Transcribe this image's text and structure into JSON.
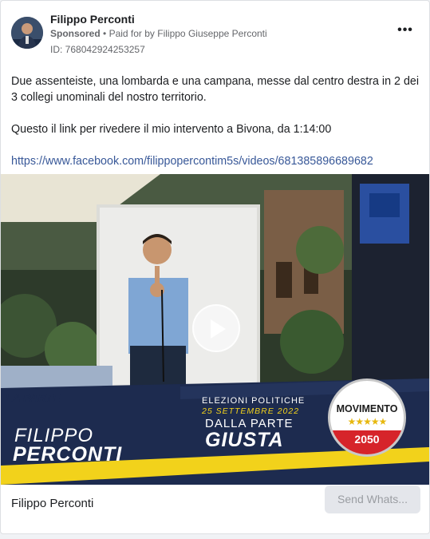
{
  "post": {
    "page_name": "Filippo Perconti",
    "sponsored": "Sponsored",
    "paid_for": "Paid for by Filippo Giuseppe Perconti",
    "ad_id": "ID: 768042924253257",
    "paragraph1": "Due assenteiste, una lombarda e una campana, messe dal centro destra in 2 dei 3 collegi unominali del nostro territorio.",
    "paragraph2": "Questo il link per rivedere il mio intervento a Bivona, da 1:14:00",
    "link": "https://www.facebook.com/filippopercontim5s/videos/681385896689682"
  },
  "media": {
    "banner_line1": "ELEZIONI POLITICHE",
    "banner_line2": "25 SETTEMBRE 2022",
    "banner_line3": "DALLA PARTE",
    "banner_line4": "GIUSTA",
    "candidate_first": "FILIPPO",
    "candidate_last": "PERCONTI",
    "logo_text": "MOVIMENTO",
    "logo_year": "2050",
    "left_banner_text": "LA PARTE"
  },
  "footer": {
    "name": "Filippo Perconti",
    "cta_label": "Send Whats..."
  },
  "colors": {
    "link": "#385898",
    "navy": "#1d2b4f",
    "yellow": "#f2d21b",
    "logo_red": "#d6242a"
  }
}
